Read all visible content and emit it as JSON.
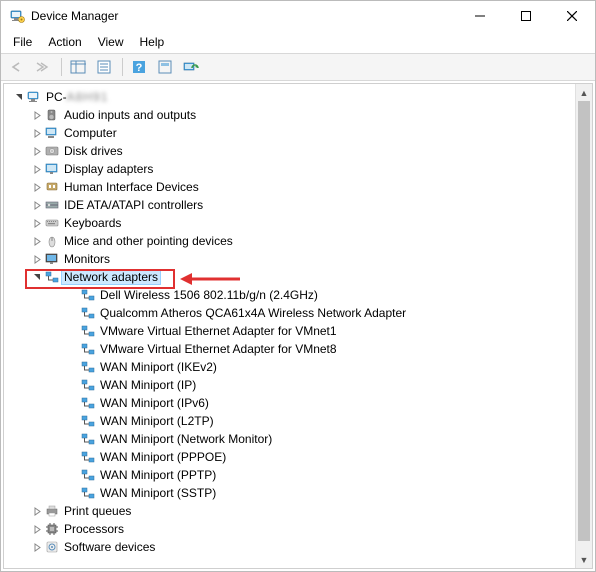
{
  "window": {
    "title": "Device Manager"
  },
  "menu": {
    "items": [
      "File",
      "Action",
      "View",
      "Help"
    ]
  },
  "tree": {
    "root": {
      "label_prefix": "PC-",
      "label_blur": "A8H91"
    },
    "categories": [
      {
        "label": "Audio inputs and outputs",
        "expanded": false,
        "icon": "speaker"
      },
      {
        "label": "Computer",
        "expanded": false,
        "icon": "computer"
      },
      {
        "label": "Disk drives",
        "expanded": false,
        "icon": "disk"
      },
      {
        "label": "Display adapters",
        "expanded": false,
        "icon": "display"
      },
      {
        "label": "Human Interface Devices",
        "expanded": false,
        "icon": "hid"
      },
      {
        "label": "IDE ATA/ATAPI controllers",
        "expanded": false,
        "icon": "ide"
      },
      {
        "label": "Keyboards",
        "expanded": false,
        "icon": "keyboard"
      },
      {
        "label": "Mice and other pointing devices",
        "expanded": false,
        "icon": "mouse"
      },
      {
        "label": "Monitors",
        "expanded": false,
        "icon": "monitor"
      },
      {
        "label": "Network adapters",
        "expanded": true,
        "icon": "network",
        "highlight": true,
        "children": [
          "Dell Wireless 1506 802.11b/g/n (2.4GHz)",
          "Qualcomm Atheros QCA61x4A Wireless Network Adapter",
          "VMware Virtual Ethernet Adapter for VMnet1",
          "VMware Virtual Ethernet Adapter for VMnet8",
          "WAN Miniport (IKEv2)",
          "WAN Miniport (IP)",
          "WAN Miniport (IPv6)",
          "WAN Miniport (L2TP)",
          "WAN Miniport (Network Monitor)",
          "WAN Miniport (PPPOE)",
          "WAN Miniport (PPTP)",
          "WAN Miniport (SSTP)"
        ]
      },
      {
        "label": "Print queues",
        "expanded": false,
        "icon": "printer"
      },
      {
        "label": "Processors",
        "expanded": false,
        "icon": "cpu"
      },
      {
        "label": "Software devices",
        "expanded": false,
        "icon": "software"
      }
    ]
  }
}
